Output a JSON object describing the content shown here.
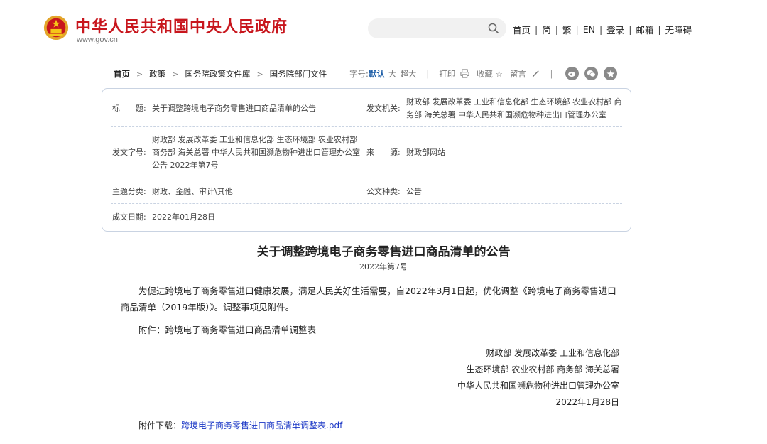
{
  "header": {
    "site_title": "中华人民共和国中央人民政府",
    "site_url": "www.gov.cn",
    "search_placeholder": "",
    "nav": [
      "首页",
      "简",
      "繁",
      "EN",
      "登录",
      "邮箱",
      "无障碍"
    ],
    "nav_separator": "|",
    "accent_color": "#c8161d"
  },
  "breadcrumb": {
    "items": [
      "首页",
      "政策",
      "国务院政策文件库",
      "国务院部门文件"
    ],
    "arrow": ">"
  },
  "tools": {
    "font_size_label": "字号:",
    "font_default": "默认",
    "font_large": "大",
    "font_xlarge": "超大",
    "separator": "|",
    "print": "打印",
    "favorite": "收藏",
    "comment": "留言",
    "share_icons": [
      "weibo-icon",
      "wechat-icon",
      "qzone-icon"
    ]
  },
  "meta": {
    "title_label": "标　　题:",
    "title_value": "关于调整跨境电子商务零售进口商品清单的公告",
    "issuer_label": "发文机关:",
    "issuer_value": "财政部 发展改革委 工业和信息化部 生态环境部 农业农村部 商务部 海关总署 中华人民共和国濒危物种进出口管理办公室",
    "doc_no_label": "发文字号:",
    "doc_no_value": "财政部 发展改革委 工业和信息化部 生态环境部 农业农村部 商务部 海关总署 中华人民共和国濒危物种进出口管理办公室公告 2022年第7号",
    "source_label": "来　　源:",
    "source_value": "财政部网站",
    "category_label": "主题分类:",
    "category_value": "财政、金融、审计\\其他",
    "type_label": "公文种类:",
    "type_value": "公告",
    "date_label": "成文日期:",
    "date_value": "2022年01月28日"
  },
  "document": {
    "title": "关于调整跨境电子商务零售进口商品清单的公告",
    "number": "2022年第7号",
    "paragraph1": "为促进跨境电子商务零售进口健康发展，满足人民美好生活需要，自2022年3月1日起，优化调整《跨境电子商务零售进口商品清单（2019年版）》。调整事项见附件。",
    "paragraph2": "附件：跨境电子商务零售进口商品清单调整表",
    "signatures": [
      "财政部 发展改革委 工业和信息化部",
      "生态环境部 农业农村部 商务部 海关总署",
      "中华人民共和国濒危物种进出口管理办公室",
      "2022年1月28日"
    ],
    "download_label": "附件下载：",
    "download_link": "跨境电子商务零售进口商品清单调整表.pdf"
  }
}
